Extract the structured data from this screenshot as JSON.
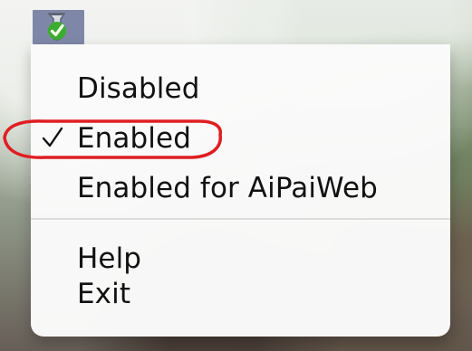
{
  "menu_bar": {
    "status_icon": "tray-app-icon"
  },
  "menu": {
    "items": [
      {
        "label": "Disabled"
      },
      {
        "label": "Enabled",
        "checked": true
      },
      {
        "label": "Enabled for AiPaiWeb"
      },
      {
        "label": "Help"
      },
      {
        "label": "Exit"
      }
    ]
  },
  "icons": {
    "tray_icon": "tray-app-icon",
    "check_icon": "checkmark-icon"
  },
  "colors": {
    "annotation_red": "#e01e22",
    "menu_background": "#fafafa",
    "text": "#111111",
    "tray_highlight": "#7f87a8"
  }
}
